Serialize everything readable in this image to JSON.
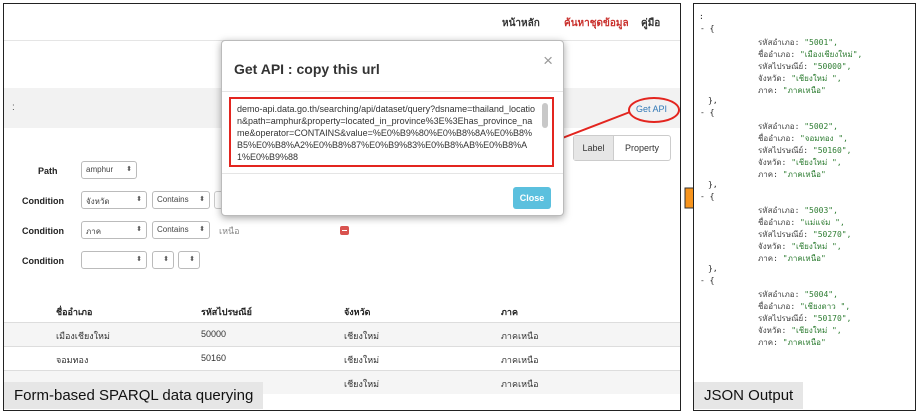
{
  "nav": {
    "home": "หน้าหลัก",
    "search": "ค้นหาชุดข้อมูล",
    "manual": "คู่มือ"
  },
  "modal": {
    "title": "Get API : copy this url",
    "close_glyph": "×",
    "url": "demo-api.data.go.th/searching/api/dataset/query?dsname=thailand_location&path=amphur&property=located_in_province%3E%3Ehas_province_name&operator=CONTAINS&value=%E0%B9%80%E0%B8%8A%E0%B8%B5%E0%B8%A2%E0%B8%87%E0%B9%83%E0%B8%AB%E0%B8%A1%E0%B9%88",
    "close_label": "Close"
  },
  "get_api_label": "Get API",
  "toggle": {
    "label": "Label",
    "property": "Property"
  },
  "form": {
    "path_label": "Path",
    "path_value": "amphur",
    "condition_label": "Condition",
    "rows": [
      {
        "property": "จังหวัด",
        "operator": "Contains",
        "value": ""
      },
      {
        "property": "ภาค",
        "operator": "Contains",
        "value": "เหนือ"
      },
      {
        "property": "",
        "operator": "",
        "value": ""
      }
    ]
  },
  "table": {
    "headers": [
      "ชื่ออำเภอ",
      "รหัสไปรษณีย์",
      "จังหวัด",
      "ภาค"
    ],
    "rows": [
      [
        "เมืองเชียงใหม่",
        "50000",
        "เชียงใหม่",
        "ภาคเหนือ"
      ],
      [
        "จอมทอง",
        "50160",
        "เชียงใหม่",
        "ภาคเหนือ"
      ],
      [
        "",
        "",
        "เชียงใหม่",
        "ภาคเหนือ"
      ]
    ]
  },
  "captions": {
    "left": "Form-based SPARQL data querying",
    "right": "JSON Output"
  },
  "json_output": {
    "keys": {
      "district_code": "รหัสอำเภอ",
      "district_name": "ชื่ออำเภอ",
      "postal_code": "รหัสไปรษณีย์",
      "province": "จังหวัด",
      "region": "ภาค"
    },
    "items": [
      {
        "code": "\"5001\",",
        "name": "\"เมืองเชียงใหม่\",",
        "postal": "\"50000\",",
        "province": "\"เชียงใหม่ \",",
        "region": "\"ภาคเหนือ\""
      },
      {
        "code": "\"5002\",",
        "name": "\"จอมทอง \",",
        "postal": "\"50160\",",
        "province": "\"เชียงใหม่ \",",
        "region": "\"ภาคเหนือ\""
      },
      {
        "code": "\"5003\",",
        "name": "\"แม่แจ่ม \",",
        "postal": "\"50270\",",
        "province": "\"เชียงใหม่ \",",
        "region": "\"ภาคเหนือ\""
      },
      {
        "code": "\"5004\",",
        "name": "\"เชียงดาว \",",
        "postal": "\"50170\",",
        "province": "\"เชียงใหม่ \",",
        "region": "\"ภาคเหนือ\""
      }
    ]
  },
  "colors": {
    "highlight": "#e3251f",
    "arrow": "#f7941d",
    "close_button": "#5bc0de",
    "json_value": "#2e7d32"
  }
}
